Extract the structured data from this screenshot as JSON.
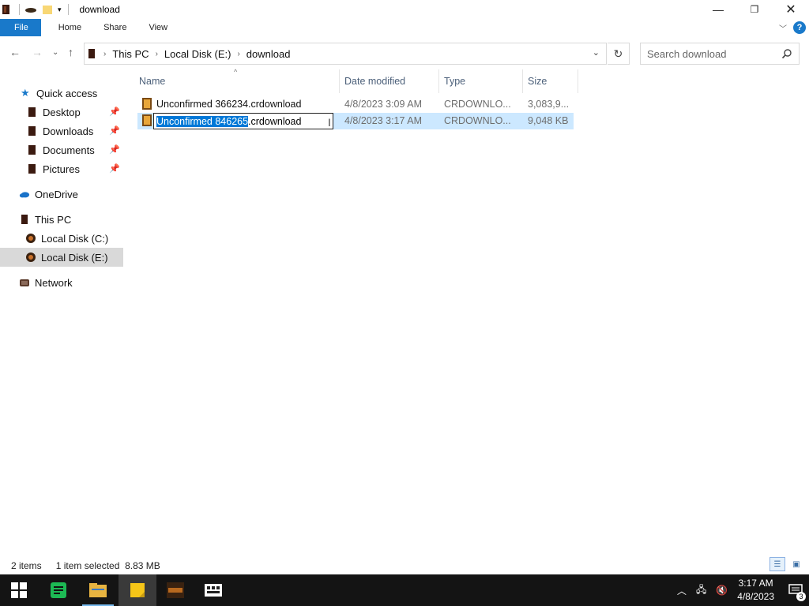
{
  "window": {
    "title": "download",
    "minimize_icon": "minimize-icon",
    "maximize_icon": "restore-icon",
    "close_icon": "close-icon"
  },
  "ribbon": {
    "tabs": [
      "File",
      "Home",
      "Share",
      "View"
    ],
    "help_label": "?"
  },
  "address": {
    "crumbs": [
      "This PC",
      "Local Disk (E:)",
      "download"
    ]
  },
  "search": {
    "placeholder": "Search download"
  },
  "nav": {
    "items": [
      {
        "label": "Quick access",
        "icon": "star-icon",
        "pinned": false
      },
      {
        "label": "Desktop",
        "icon": "desktop-folder-icon",
        "pinned": true
      },
      {
        "label": "Downloads",
        "icon": "downloads-folder-icon",
        "pinned": true
      },
      {
        "label": "Documents",
        "icon": "documents-folder-icon",
        "pinned": true
      },
      {
        "label": "Pictures",
        "icon": "pictures-folder-icon",
        "pinned": true
      },
      {
        "label": "OneDrive",
        "icon": "cloud-icon",
        "pinned": false
      },
      {
        "label": "This PC",
        "icon": "computer-icon",
        "pinned": false
      },
      {
        "label": "Local Disk (C:)",
        "icon": "drive-icon",
        "pinned": false
      },
      {
        "label": "Local Disk (E:)",
        "icon": "drive-icon",
        "pinned": false,
        "selected": true
      },
      {
        "label": "Network",
        "icon": "network-icon",
        "pinned": false
      }
    ]
  },
  "columns": {
    "name": "Name",
    "date": "Date modified",
    "type": "Type",
    "size": "Size"
  },
  "files": [
    {
      "name": "Unconfirmed 366234.crdownload",
      "date": "4/8/2023 3:09 AM",
      "type": "CRDOWNLO...",
      "size": "3,083,9..."
    },
    {
      "name_selected_part": "Unconfirmed 846265",
      "name_rest": ".crdownload",
      "date": "4/8/2023 3:17 AM",
      "type": "CRDOWNLO...",
      "size": "9,048 KB",
      "renaming": true
    }
  ],
  "status": {
    "count": "2 items",
    "selection": "1 item selected  8.83 MB"
  },
  "taskbar": {
    "time": "3:17 AM",
    "date": "4/8/2023",
    "notification_count": "3",
    "apps": [
      "start-icon",
      "spotify-icon",
      "file-explorer-icon",
      "sticky-notes-icon",
      "game-icon",
      "app-icon"
    ]
  },
  "colors": {
    "accent": "#1979ca",
    "selection": "#cce8ff",
    "text_selection": "#0078d7"
  }
}
